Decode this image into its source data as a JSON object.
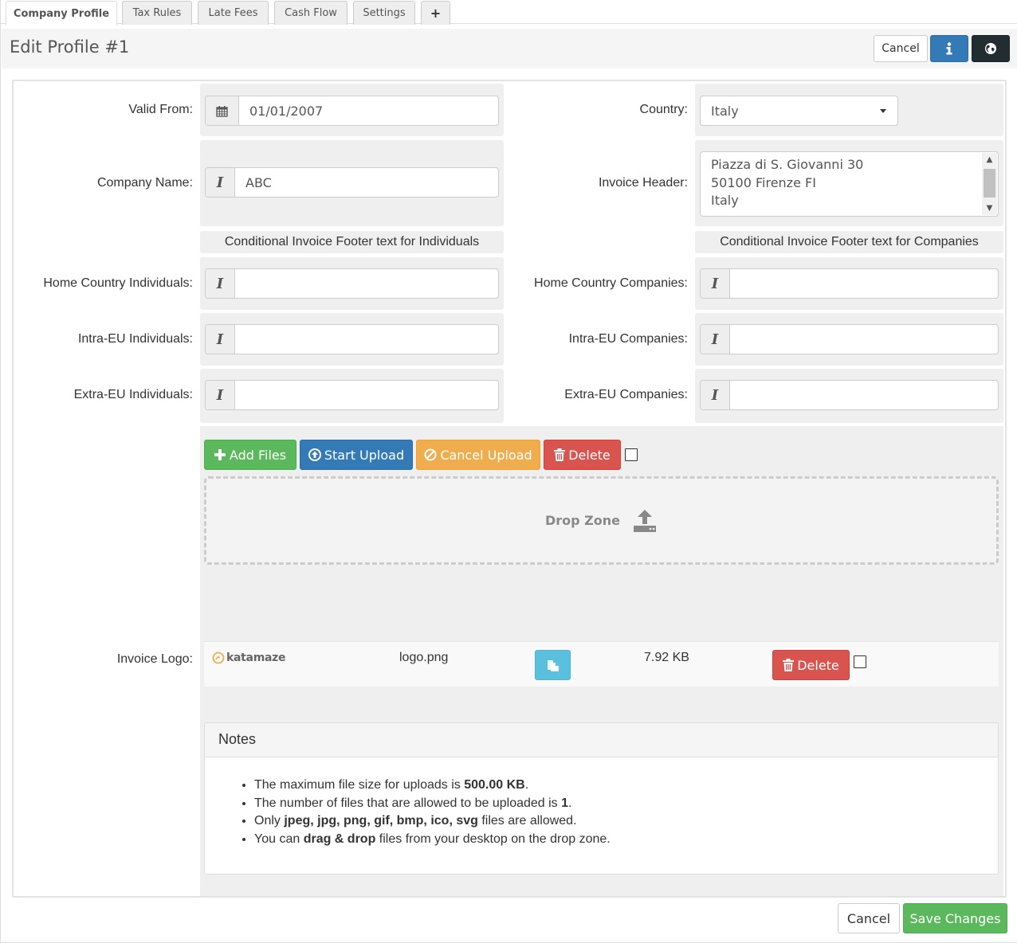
{
  "tabs": [
    {
      "label": "Company Profile",
      "active": true
    },
    {
      "label": "Tax Rules",
      "active": false
    },
    {
      "label": "Late Fees",
      "active": false
    },
    {
      "label": "Cash Flow",
      "active": false
    },
    {
      "label": "Settings",
      "active": false
    },
    {
      "label": "+",
      "icon": "plus-icon",
      "active": false
    }
  ],
  "header": {
    "title": "Edit Profile #1",
    "cancel_label": "Cancel",
    "info_icon": "info-icon",
    "globe_icon": "globe-icon"
  },
  "form": {
    "valid_from": {
      "label": "Valid From:",
      "value": "01/01/2007",
      "icon": "calendar-icon"
    },
    "country": {
      "label": "Country:",
      "value": "Italy"
    },
    "company_name": {
      "label": "Company Name:",
      "value": "ABC",
      "icon": "text-cursor-icon"
    },
    "invoice_header": {
      "label": "Invoice Header:",
      "lines": [
        "Piazza di S. Giovanni 30",
        "50100 Firenze FI",
        "Italy"
      ]
    },
    "individuals_heading": "Conditional Invoice Footer text for Individuals",
    "companies_heading": "Conditional Invoice Footer text for Companies",
    "home_individuals": {
      "label": "Home Country Individuals:",
      "value": ""
    },
    "intra_individuals": {
      "label": "Intra-EU Individuals:",
      "value": ""
    },
    "extra_individuals": {
      "label": "Extra-EU Individuals:",
      "value": ""
    },
    "home_companies": {
      "label": "Home Country Companies:",
      "value": ""
    },
    "intra_companies": {
      "label": "Intra-EU Companies:",
      "value": ""
    },
    "extra_companies": {
      "label": "Extra-EU Companies:",
      "value": ""
    }
  },
  "upload": {
    "add_files": "Add Files",
    "start_upload": "Start Upload",
    "cancel_upload": "Cancel Upload",
    "delete": "Delete",
    "drop_zone": "Drop Zone",
    "logo_label": "Invoice Logo:",
    "file": {
      "logo_text": "katamaze",
      "name": "logo.png",
      "size": "7.92 KB",
      "delete": "Delete"
    }
  },
  "notes": {
    "title": "Notes",
    "items": [
      {
        "pre": "The maximum file size for uploads is ",
        "bold": "500.00 KB",
        "post": "."
      },
      {
        "pre": "The number of files that are allowed to be uploaded is ",
        "bold": "1",
        "post": "."
      },
      {
        "pre": "Only ",
        "bold": "jpeg, jpg, png, gif, bmp, ico, svg",
        "post": " files are allowed."
      },
      {
        "pre": "You can ",
        "bold": "drag & drop",
        "post": " files from your desktop on the drop zone."
      }
    ]
  },
  "footer": {
    "cancel_label": "Cancel",
    "save_label": "Save Changes"
  },
  "colors": {
    "primary": "#337ab7",
    "success": "#5cb85c",
    "warning": "#f0ad4e",
    "danger": "#d9534f",
    "info": "#5bc0de",
    "dark": "#222d32"
  }
}
